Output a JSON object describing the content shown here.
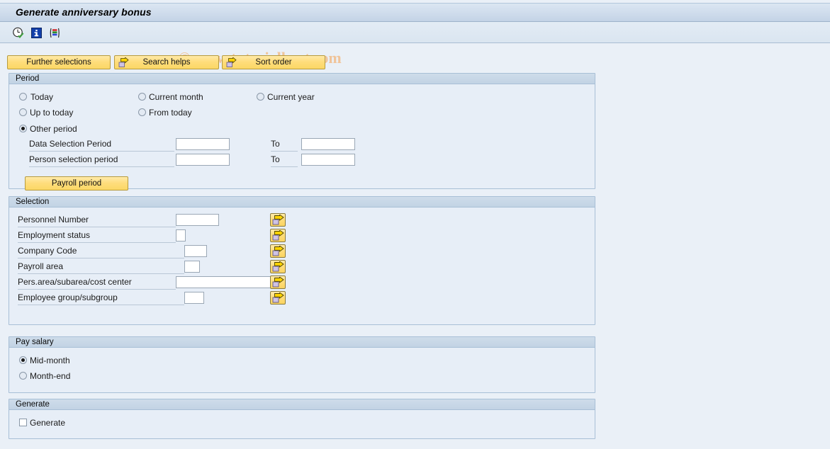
{
  "window": {
    "title": "Generate anniversary bonus"
  },
  "watermark": {
    "text": "© www.tutorialkart.com"
  },
  "toolbar": {
    "icons": [
      {
        "name": "execute-icon",
        "tooltip": "Execute"
      },
      {
        "name": "info-icon",
        "tooltip": "Information"
      },
      {
        "name": "selection-icon",
        "tooltip": "Selection"
      }
    ]
  },
  "buttons": {
    "further_selections": "Further selections",
    "search_helps": "Search helps",
    "sort_order": "Sort order"
  },
  "period": {
    "legend": "Period",
    "options": [
      {
        "label": "Today",
        "selected": false
      },
      {
        "label": "Current month",
        "selected": false
      },
      {
        "label": "Current year",
        "selected": false
      },
      {
        "label": "Up to today",
        "selected": false
      },
      {
        "label": "From today",
        "selected": false
      },
      {
        "label": "Other period",
        "selected": true
      }
    ],
    "to_label_1": "To",
    "to_label_2": "To",
    "fields": [
      {
        "label": "Data Selection Period",
        "from_value": "",
        "to_value": ""
      },
      {
        "label": "Person selection period",
        "from_value": "",
        "to_value": ""
      }
    ],
    "payroll_period_button": "Payroll period"
  },
  "selection": {
    "legend": "Selection",
    "rows": [
      {
        "label": "Personnel Number",
        "value": ""
      },
      {
        "label": "Employment status",
        "value": ""
      },
      {
        "label": "Company Code",
        "value": ""
      },
      {
        "label": "Payroll area",
        "value": ""
      },
      {
        "label": "Pers.area/subarea/cost center",
        "value": ""
      },
      {
        "label": "Employee group/subgroup",
        "value": ""
      }
    ]
  },
  "pay_salary": {
    "legend": "Pay salary",
    "options": [
      {
        "label": "Mid-month",
        "selected": true
      },
      {
        "label": "Month-end",
        "selected": false
      }
    ]
  },
  "generate": {
    "legend": "Generate",
    "checkbox_label": "Generate",
    "checked": false
  },
  "colors": {
    "background": "#eaf0f7",
    "title_bar": "#cfdcec",
    "group_header": "#c6d6e6",
    "group_body": "#e7eef7",
    "button_yellow": "#ffdd7a",
    "watermark": "#f0c49a"
  }
}
